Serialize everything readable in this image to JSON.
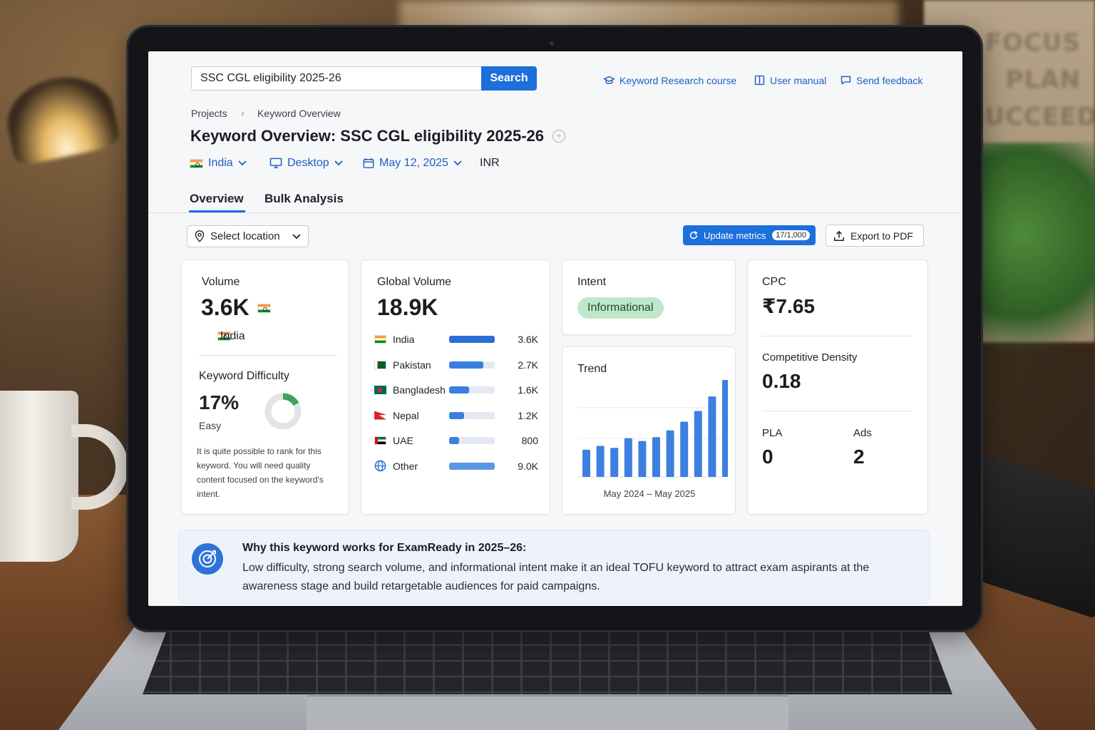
{
  "search": {
    "value": "SSC CGL eligibility 2025-26",
    "button_label": "Search"
  },
  "top_links": {
    "course": "Keyword Research course",
    "manual": "User manual",
    "feedback": "Send feedback"
  },
  "breadcrumb": {
    "items": [
      "Projects",
      "Keyword Overview"
    ]
  },
  "page_title": "Keyword Overview: SSC CGL eligibility 2025-26",
  "filters": {
    "country": "India",
    "device": "Desktop",
    "date": "May 12, 2025",
    "currency": "INR"
  },
  "tabs": [
    "Overview",
    "Bulk Analysis"
  ],
  "toolbar": {
    "location_placeholder": "Select location",
    "update_label": "Update metrics",
    "update_badge": "17/1,000",
    "export_label": "Export to PDF"
  },
  "volume": {
    "label": "Volume",
    "value": "3.6K",
    "country": "India"
  },
  "keyword_difficulty": {
    "label": "Keyword Difficulty",
    "value": "17%",
    "percent": 17,
    "level": "Easy",
    "description": "It is quite possible to rank for this keyword. You will need quality content focused on the keyword's intent.",
    "accent": "#3aa55c"
  },
  "global_volume": {
    "label": "Global Volume",
    "value": "18.9K",
    "rows": [
      {
        "country": "India",
        "value": "3.6K",
        "fraction": 1.0
      },
      {
        "country": "Pakistan",
        "value": "2.7K",
        "fraction": 0.75
      },
      {
        "country": "Bangladesh",
        "value": "1.6K",
        "fraction": 0.44
      },
      {
        "country": "Nepal",
        "value": "1.2K",
        "fraction": 0.33
      },
      {
        "country": "UAE",
        "value": "800",
        "fraction": 0.22
      },
      {
        "country": "Other",
        "value": "9.0K",
        "fraction": 1.0
      }
    ]
  },
  "intent": {
    "label": "Intent",
    "value": "Informational",
    "color": "#bfe8cb"
  },
  "trend": {
    "label": "Trend",
    "range": "May 2024 – May 2025"
  },
  "chart_data": {
    "type": "bar",
    "values": [
      0.28,
      0.32,
      0.3,
      0.4,
      0.37,
      0.41,
      0.48,
      0.57,
      0.68,
      0.83,
      1.0
    ],
    "ylim": [
      0,
      1
    ],
    "color": "#3c7fe0"
  },
  "cpc": {
    "label": "CPC",
    "value": "₹7.65"
  },
  "competitive_density": {
    "label": "Competitive Density",
    "value": "0.18"
  },
  "pla": {
    "label": "PLA",
    "value": "0"
  },
  "ads": {
    "label": "Ads",
    "value": "2"
  },
  "insight": {
    "title": "Why this keyword works for ExamReady in 2025–26:",
    "body": "Low difficulty, strong search volume, and informational intent make it an ideal TOFU keyword to attract exam aspirants at the awareness stage and build retargetable audiences for paid campaigns."
  },
  "colors": {
    "accent": "#1d6fdc",
    "link": "#1f5fc4"
  },
  "wall_words": [
    "FOCUS",
    "PLAN",
    "SUCCEED"
  ]
}
